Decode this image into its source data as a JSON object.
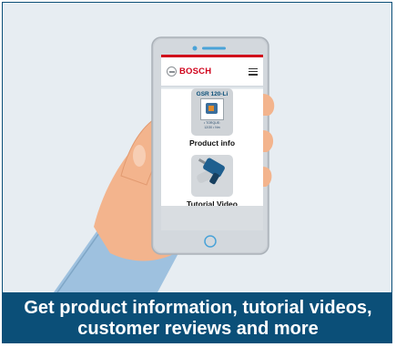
{
  "screen": {
    "brand": "BOSCH",
    "menu_icon": "hamburger-menu-icon",
    "product": {
      "model": "GSR 120-Li",
      "spec_line1": "• TORQUE:",
      "spec_line2": "12/30 • Nm",
      "label": "Product info"
    },
    "video": {
      "label": "Tutorial Video"
    }
  },
  "banner": {
    "line1": "Get product information, tutorial videos,",
    "line2": "customer reviews and more"
  },
  "colors": {
    "banner_bg": "#0b4f78",
    "brand_red": "#d0021b",
    "skin": "#f3b48d",
    "sleeve": "#9ec1df",
    "phone_body": "#c9ced4"
  }
}
